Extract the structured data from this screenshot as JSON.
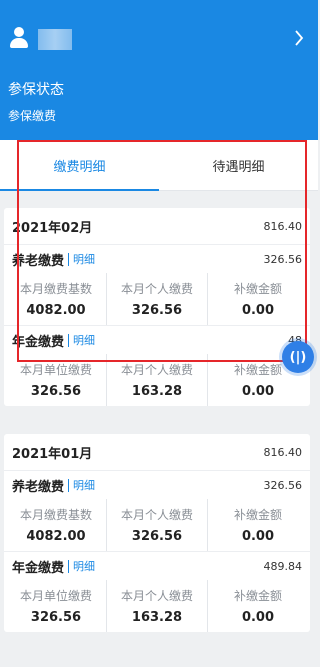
{
  "header": {
    "status_title": "参保状态",
    "status_sub": "参保缴费"
  },
  "tabs": [
    {
      "label": "缴费明细",
      "active": true
    },
    {
      "label": "待遇明细",
      "active": false
    }
  ],
  "months": [
    {
      "date": "2021年02月",
      "total": "816.40",
      "sections": [
        {
          "name": "养老缴费",
          "link": "明细",
          "total": "326.56",
          "cols": [
            {
              "label": "本月缴费基数",
              "value": "4082.00"
            },
            {
              "label": "本月个人缴费",
              "value": "326.56"
            },
            {
              "label": "补缴金额",
              "value": "0.00"
            }
          ]
        },
        {
          "name": "年金缴费",
          "link": "明细",
          "total": "48",
          "cols": [
            {
              "label": "本月单位缴费",
              "value": "326.56"
            },
            {
              "label": "本月个人缴费",
              "value": "163.28"
            },
            {
              "label": "补缴金额",
              "value": "0.00"
            }
          ]
        }
      ]
    },
    {
      "date": "2021年01月",
      "total": "816.40",
      "sections": [
        {
          "name": "养老缴费",
          "link": "明细",
          "total": "326.56",
          "cols": [
            {
              "label": "本月缴费基数",
              "value": "4082.00"
            },
            {
              "label": "本月个人缴费",
              "value": "326.56"
            },
            {
              "label": "补缴金额",
              "value": "0.00"
            }
          ]
        },
        {
          "name": "年金缴费",
          "link": "明细",
          "total": "489.84",
          "cols": [
            {
              "label": "本月单位缴费",
              "value": "326.56"
            },
            {
              "label": "本月个人缴费",
              "value": "163.28"
            },
            {
              "label": "补缴金额",
              "value": "0.00"
            }
          ]
        }
      ]
    }
  ],
  "floating_button": {
    "label": "(|)"
  },
  "colors": {
    "accent": "#1a88e3",
    "highlight_box": "#e5262a",
    "background": "#eef0f2"
  }
}
